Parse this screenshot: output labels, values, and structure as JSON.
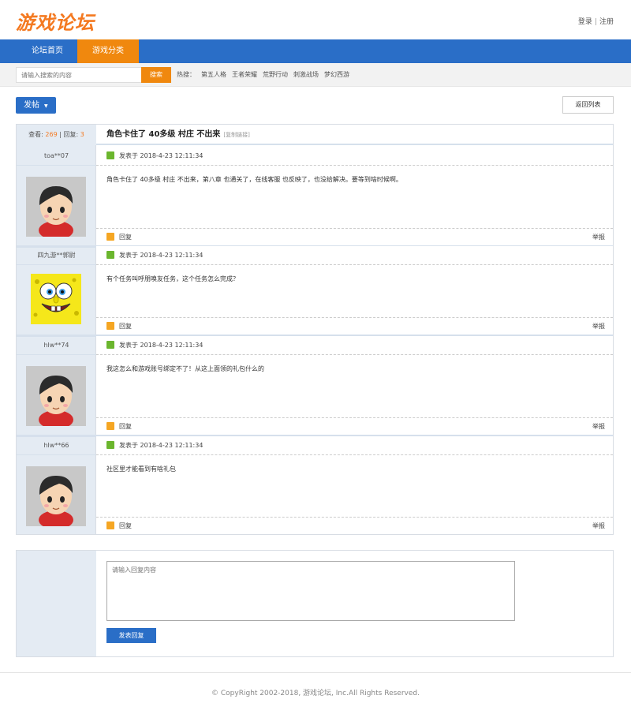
{
  "header": {
    "logo": "游戏论坛",
    "login": "登录",
    "sep": "|",
    "register": "注册"
  },
  "nav": {
    "tabs": [
      {
        "label": "论坛首页"
      },
      {
        "label": "游戏分类"
      }
    ],
    "active_color": "#f0880e",
    "bar_color": "#2a6ec7"
  },
  "search": {
    "placeholder": "请输入搜索的内容",
    "button": "搜索",
    "hot_label": "热搜：",
    "hot": [
      "第五人格",
      "王者荣耀",
      "荒野行动",
      "刺激战场",
      "梦幻西游"
    ]
  },
  "toolbar": {
    "post_button": "发帖",
    "back_button": "返回列表"
  },
  "thread": {
    "views_label": "查看:",
    "views": "269",
    "replies_label": "回复:",
    "replies": "3",
    "title": "角色卡住了 40多级 村庄 不出来",
    "copy_link": "[复制链接]",
    "posts": [
      {
        "user": "toa**07",
        "avatar": "cartoon-boy-avatar",
        "time_label": "发表于",
        "time": "2018-4-23 12:11:34",
        "content": "角色卡住了 40多级 村庄 不出来，第八章 也通关了，在线客服 也反映了，也没给解决。要等到啥时候啊。",
        "reply": "回复",
        "report": "举报"
      },
      {
        "user": "四九游**郭尉",
        "avatar": "spongebob-avatar",
        "time_label": "发表于",
        "time": "2018-4-23 12:11:34",
        "content": "有个任务叫呼朋唤友任务，这个任务怎么完成？",
        "reply": "回复",
        "report": "举报"
      },
      {
        "user": "hlw**74",
        "avatar": "cartoon-boy-avatar",
        "time_label": "发表于",
        "time": "2018-4-23 12:11:34",
        "content": "我这怎么和游戏账号绑定不了！从这上面领的礼包什么的",
        "reply": "回复",
        "report": "举报"
      },
      {
        "user": "hlw**66",
        "avatar": "cartoon-boy-avatar",
        "time_label": "发表于",
        "time": "2018-4-23 12:11:34",
        "content": "社区里才能看到有啥礼包",
        "reply": "回复",
        "report": "举报"
      }
    ]
  },
  "reply_form": {
    "placeholder": "请输入回复内容",
    "submit": "发表回复"
  },
  "footer": {
    "copyright": "© CopyRight 2002-2018, 游戏论坛, Inc.All Rights Reserved."
  }
}
